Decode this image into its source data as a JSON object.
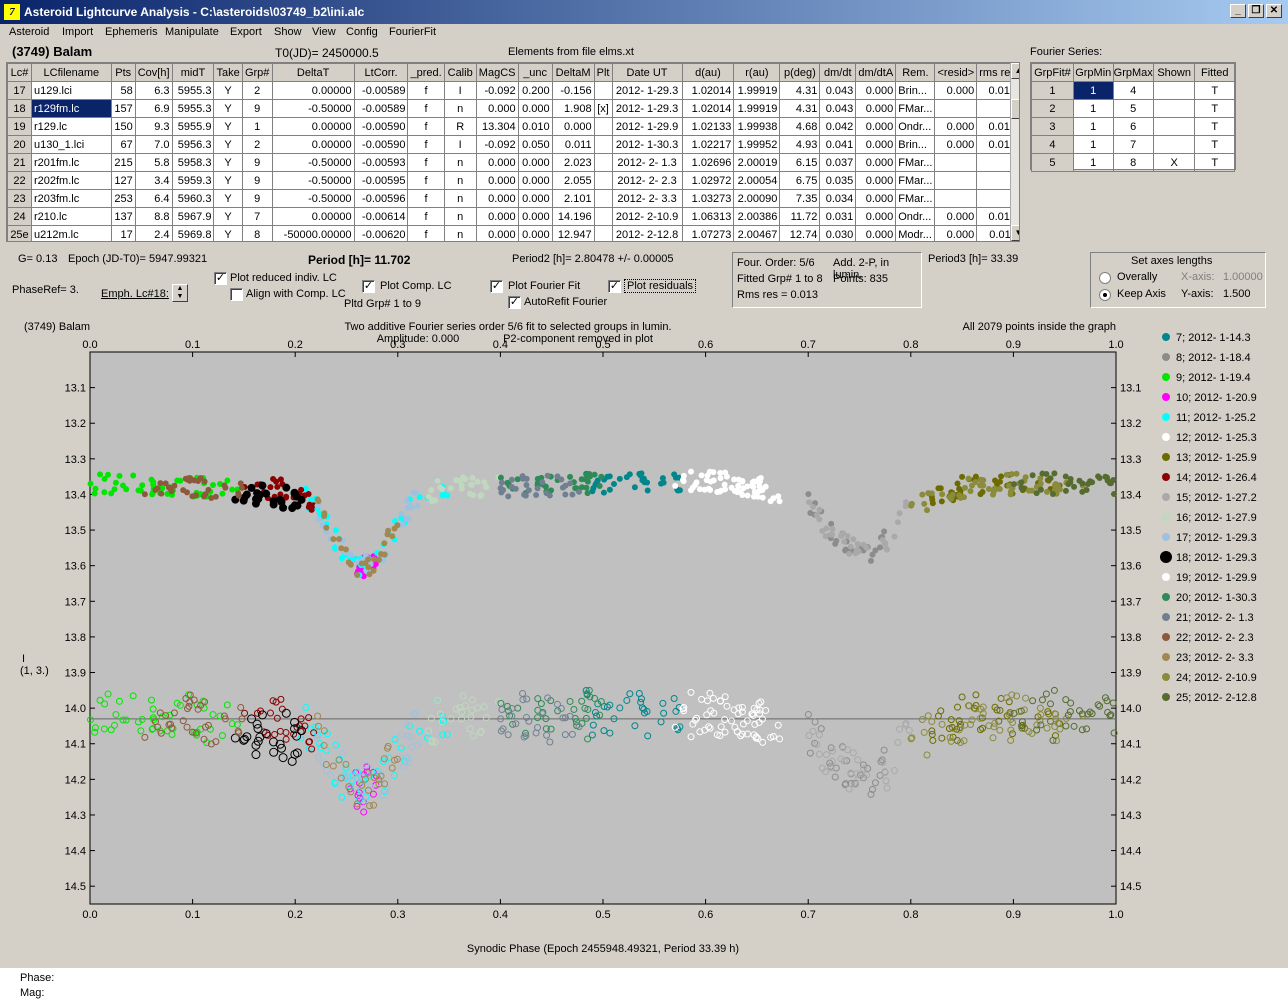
{
  "window": {
    "title": "Asteroid Lightcurve Analysis - C:\\asteroids\\03749_b2\\ini.alc",
    "icon": "7"
  },
  "menu": [
    "Asteroid",
    "Import",
    "Ephemeris",
    "Manipulate",
    "Export",
    "Show",
    "View",
    "Config",
    "FourierFit"
  ],
  "header": {
    "object": "(3749) Balam",
    "t0": "T0(JD)= 2450000.5",
    "elements": "Elements from file elms.xt",
    "fourier_series": "Fourier Series:"
  },
  "table": {
    "columns": [
      "Lc#",
      "LCfilename",
      "Pts",
      "Cov[h]",
      "midT",
      "Take",
      "Grp#",
      "DeltaT",
      "LtCorr.",
      "_pred.",
      "Calib",
      "MagCS",
      "_unc",
      "DeltaM",
      "Plt",
      "Date UT",
      "d(au)",
      "r(au)",
      "p(deg)",
      "dm/dt",
      "dm/dtA",
      "Rem.",
      "<resid>",
      "rms res"
    ],
    "rows": [
      [
        "17",
        "u129.lci",
        "58",
        "6.3",
        "5955.3",
        "Y",
        "2",
        "0.00000",
        "-0.00589",
        "f",
        "I",
        "-0.092",
        "0.200",
        "-0.156",
        "",
        "2012- 1-29.3",
        "1.02014",
        "1.99919",
        "4.31",
        "0.043",
        "0.000",
        "Brin...",
        "0.000",
        "0.012"
      ],
      [
        "18",
        "r129fm.lc",
        "157",
        "6.9",
        "5955.3",
        "Y",
        "9",
        "-0.50000",
        "-0.00589",
        "f",
        "n",
        "0.000",
        "0.000",
        "1.908",
        "[x]",
        "2012- 1-29.3",
        "1.02014",
        "1.99919",
        "4.31",
        "0.043",
        "0.000",
        "FMar...",
        "",
        ""
      ],
      [
        "19",
        "r129.lc",
        "150",
        "9.3",
        "5955.9",
        "Y",
        "1",
        "0.00000",
        "-0.00590",
        "f",
        "R",
        "13.304",
        "0.010",
        "0.000",
        "",
        "2012- 1-29.9",
        "1.02133",
        "1.99938",
        "4.68",
        "0.042",
        "0.000",
        "Ondr...",
        "0.000",
        "0.014"
      ],
      [
        "20",
        "u130_1.lci",
        "67",
        "7.0",
        "5956.3",
        "Y",
        "2",
        "0.00000",
        "-0.00590",
        "f",
        "I",
        "-0.092",
        "0.050",
        "0.011",
        "",
        "2012- 1-30.3",
        "1.02217",
        "1.99952",
        "4.93",
        "0.041",
        "0.000",
        "Brin...",
        "0.000",
        "0.013"
      ],
      [
        "21",
        "r201fm.lc",
        "215",
        "5.8",
        "5958.3",
        "Y",
        "9",
        "-0.50000",
        "-0.00593",
        "f",
        "n",
        "0.000",
        "0.000",
        "2.023",
        "",
        "2012- 2- 1.3",
        "1.02696",
        "2.00019",
        "6.15",
        "0.037",
        "0.000",
        "FMar...",
        "",
        ""
      ],
      [
        "22",
        "r202fm.lc",
        "127",
        "3.4",
        "5959.3",
        "Y",
        "9",
        "-0.50000",
        "-0.00595",
        "f",
        "n",
        "0.000",
        "0.000",
        "2.055",
        "",
        "2012- 2- 2.3",
        "1.02972",
        "2.00054",
        "6.75",
        "0.035",
        "0.000",
        "FMar...",
        "",
        ""
      ],
      [
        "23",
        "r203fm.lc",
        "253",
        "6.4",
        "5960.3",
        "Y",
        "9",
        "-0.50000",
        "-0.00596",
        "f",
        "n",
        "0.000",
        "0.000",
        "2.101",
        "",
        "2012- 2- 3.3",
        "1.03273",
        "2.00090",
        "7.35",
        "0.034",
        "0.000",
        "FMar...",
        "",
        ""
      ],
      [
        "24",
        "r210.lc",
        "137",
        "8.8",
        "5967.9",
        "Y",
        "7",
        "0.00000",
        "-0.00614",
        "f",
        "n",
        "0.000",
        "0.000",
        "14.196",
        "",
        "2012- 2-10.9",
        "1.06313",
        "2.00386",
        "11.72",
        "0.031",
        "0.000",
        "Ondr...",
        "0.000",
        "0.016"
      ],
      [
        "25e",
        "u212m.lc",
        "17",
        "2.4",
        "5969.8",
        "Y",
        "8",
        "-50000.00000",
        "-0.00620",
        "f",
        "n",
        "0.000",
        "0.000",
        "12.947",
        "",
        "2012- 2-12.8",
        "1.07273",
        "2.00467",
        "12.74",
        "0.030",
        "0.000",
        "Modr...",
        "0.000",
        "0.011"
      ]
    ]
  },
  "fourier_table": {
    "columns": [
      "GrpFit#",
      "GrpMin",
      "GrpMax",
      "Shown",
      "Fitted"
    ],
    "rows": [
      [
        "1",
        "1",
        "4",
        "",
        "T"
      ],
      [
        "2",
        "1",
        "5",
        "",
        "T"
      ],
      [
        "3",
        "1",
        "6",
        "",
        "T"
      ],
      [
        "4",
        "1",
        "7",
        "",
        "T"
      ],
      [
        "5",
        "1",
        "8",
        "X",
        "T"
      ]
    ]
  },
  "info": {
    "g": "G= 0.13",
    "epoch": "Epoch (JD-T0)= 5947.99321",
    "period": "Period [h]= 11.702",
    "period2": "Period2 [h]= 2.80478 +/- 0.00005",
    "period3": "Period3 [h]= 33.39",
    "phase_ref": "PhaseRef= 3.",
    "emph": "Emph. Lc#18:",
    "plot_reduced": "Plot reduced indiv. LC",
    "align": "Align with Comp. LC",
    "plot_comp": "Plot Comp. LC",
    "pltd_grp": "Pltd Grp#  1   to   9",
    "plot_fourier": "Plot Fourier Fit",
    "autorefit": "AutoRefit Fourier",
    "plot_residuals": "Plot residuals",
    "four_order": "Four. Order:  5/6",
    "add_2p": "Add. 2-P, in lumin.",
    "fitted_grp": "Fitted Grp# 1 to 8",
    "points": "Points: 835",
    "rms": "Rms res     = 0.013",
    "set_axes": "Set axes lengths",
    "overally": "Overally",
    "keep_axis": "Keep Axis",
    "xaxis_label": "X-axis:",
    "xaxis_val": "1.00000",
    "yaxis_label": "Y-axis:",
    "yaxis_val": "1.500"
  },
  "status": {
    "phase": "Phase:",
    "mag": "Mag:"
  },
  "chart_data": {
    "type": "scatter",
    "title_left": "(3749) Balam",
    "title_center1": "Two additive Fourier series order 5/6 fit to selected groups in lumin.",
    "title_center2": "Amplitude: 0.000",
    "title_center3": "P2-component removed in plot",
    "title_right": "All 2079 points inside the graph",
    "xlabel": "Synodic Phase (Epoch 2455948.49321, Period 33.39 h)",
    "ylabel": "I",
    "ylabel2": "(1, 3.)",
    "xlim": [
      0,
      1
    ],
    "ylim": [
      13.0,
      14.55
    ],
    "x_ticks": [
      "0.0",
      "0.1",
      "0.2",
      "0.3",
      "0.4",
      "0.5",
      "0.6",
      "0.7",
      "0.8",
      "0.9",
      "1.0"
    ],
    "y_ticks": [
      "13.1",
      "13.2",
      "13.3",
      "13.4",
      "13.5",
      "13.6",
      "13.7",
      "13.8",
      "13.9",
      "14.0",
      "14.1",
      "14.2",
      "14.3",
      "14.4",
      "14.5"
    ],
    "residual_line": 14.03,
    "curve": [
      [
        0.0,
        13.37
      ],
      [
        0.1,
        13.38
      ],
      [
        0.15,
        13.38
      ],
      [
        0.2,
        13.39
      ],
      [
        0.22,
        13.43
      ],
      [
        0.24,
        13.53
      ],
      [
        0.26,
        13.61
      ],
      [
        0.28,
        13.59
      ],
      [
        0.3,
        13.48
      ],
      [
        0.32,
        13.4
      ],
      [
        0.35,
        13.38
      ],
      [
        0.4,
        13.38
      ],
      [
        0.5,
        13.37
      ],
      [
        0.6,
        13.36
      ],
      [
        0.65,
        13.38
      ],
      [
        0.7,
        13.42
      ],
      [
        0.72,
        13.5
      ],
      [
        0.74,
        13.55
      ],
      [
        0.76,
        13.56
      ],
      [
        0.78,
        13.52
      ],
      [
        0.8,
        13.43
      ],
      [
        0.85,
        13.38
      ],
      [
        0.9,
        13.37
      ],
      [
        1.0,
        13.37
      ]
    ],
    "series": [
      {
        "name": "7; 2012- 1-14.3",
        "color": "#00868b",
        "range": [
          0.48,
          0.58
        ],
        "hollow": false
      },
      {
        "name": "8; 2012- 1-18.4",
        "color": "#8c8c8c",
        "range": [
          0.7,
          0.78
        ],
        "hollow": false
      },
      {
        "name": "9; 2012- 1-19.4",
        "color": "#00e600",
        "range": [
          0.0,
          0.15
        ],
        "hollow": false
      },
      {
        "name": "10; 2012- 1-20.9",
        "color": "#ff00ff",
        "range": [
          0.25,
          0.28
        ],
        "hollow": false
      },
      {
        "name": "11; 2012- 1-25.2",
        "color": "#00ffff",
        "range": [
          0.2,
          0.35
        ],
        "hollow": false
      },
      {
        "name": "12; 2012- 1-25.3",
        "color": "#ffffff",
        "range": [
          0.57,
          0.66
        ],
        "hollow": false
      },
      {
        "name": "13; 2012- 1-25.9",
        "color": "#6b6b00",
        "range": [
          0.82,
          0.95
        ],
        "hollow": false
      },
      {
        "name": "14; 2012- 1-26.4",
        "color": "#8b0000",
        "range": [
          0.15,
          0.22
        ],
        "hollow": false
      },
      {
        "name": "15; 2012- 1-27.2",
        "color": "#a9a9a9",
        "range": [
          0.7,
          0.8
        ],
        "hollow": false
      },
      {
        "name": "16; 2012- 1-27.9",
        "color": "#c0d8c0",
        "range": [
          0.33,
          0.4
        ],
        "hollow": false
      },
      {
        "name": "17; 2012- 1-29.3",
        "color": "#a0c0e0",
        "range": [
          0.22,
          0.32
        ],
        "hollow": false
      },
      {
        "name": "18; 2012- 1-29.3",
        "color": "#000000",
        "range": [
          0.14,
          0.21
        ],
        "hollow": false
      },
      {
        "name": "19; 2012- 1-29.9",
        "color": "#ffffff",
        "range": [
          0.58,
          0.68
        ],
        "hollow": false
      },
      {
        "name": "20; 2012- 1-30.3",
        "color": "#2e8b57",
        "range": [
          0.4,
          0.5
        ],
        "hollow": false
      },
      {
        "name": "21; 2012- 2- 1.3",
        "color": "#708090",
        "range": [
          0.4,
          0.48
        ],
        "hollow": false
      },
      {
        "name": "22; 2012- 2- 2.3",
        "color": "#8b5a3c",
        "range": [
          0.05,
          0.15
        ],
        "hollow": false
      },
      {
        "name": "23; 2012- 2- 3.3",
        "color": "#a08850",
        "range": [
          0.22,
          0.3
        ],
        "hollow": false
      },
      {
        "name": "24; 2012- 2-10.9",
        "color": "#8b8b3c",
        "range": [
          0.8,
          0.98
        ],
        "hollow": false
      },
      {
        "name": "25; 2012- 2-12.8",
        "color": "#556b2f",
        "range": [
          0.9,
          1.0
        ],
        "hollow": false
      }
    ]
  }
}
